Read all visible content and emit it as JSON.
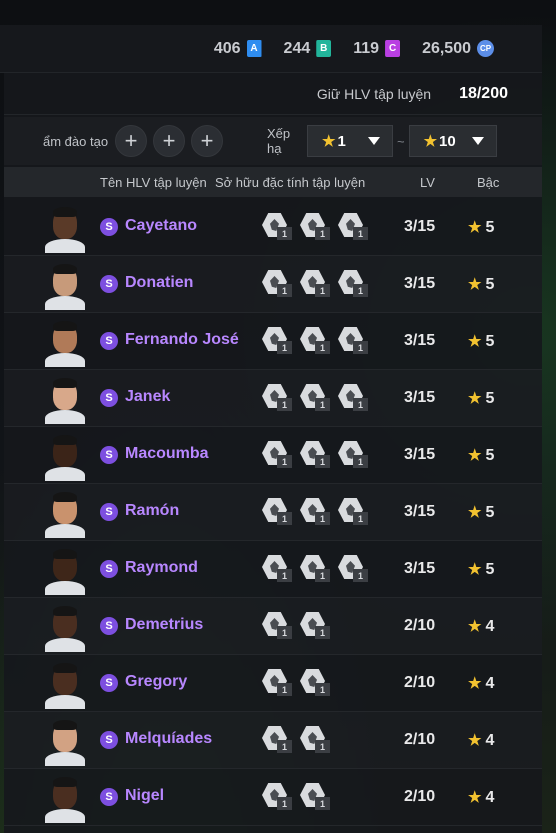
{
  "currencies": [
    {
      "value": "406",
      "badge": "A",
      "color": "#2f8df0"
    },
    {
      "value": "244",
      "badge": "B",
      "color": "#22b59b"
    },
    {
      "value": "119",
      "badge": "C",
      "color": "#b93fe2"
    },
    {
      "value": "26,500",
      "badge": "CP",
      "color": "#5c8ee8"
    }
  ],
  "coach_count": {
    "label": "Giữ HLV tập luyện",
    "value": "18/200"
  },
  "filter": {
    "training_label": "ẩm đào tạo",
    "plus": "+",
    "rank_label": "Xếp hạ",
    "rank_from": "1",
    "rank_to": "10",
    "tilde": "~",
    "star": "★"
  },
  "columns": {
    "name": "Tên HLV tập luyện",
    "traits": "Sở hữu đặc tính tập luyện",
    "lv": "LV",
    "grade": "Bậc"
  },
  "coaches": [
    {
      "name": "Cayetano",
      "lv": "3/15",
      "grade": "5",
      "traits": 3,
      "skin": "#5a3a28"
    },
    {
      "name": "Donatien",
      "lv": "3/15",
      "grade": "5",
      "traits": 3,
      "skin": "#c79a7a"
    },
    {
      "name": "Fernando José",
      "lv": "3/15",
      "grade": "5",
      "traits": 3,
      "skin": "#b07a58"
    },
    {
      "name": "Janek",
      "lv": "3/15",
      "grade": "5",
      "traits": 3,
      "skin": "#d8a88a"
    },
    {
      "name": "Macoumba",
      "lv": "3/15",
      "grade": "5",
      "traits": 3,
      "skin": "#3b2418"
    },
    {
      "name": "Ramón",
      "lv": "3/15",
      "grade": "5",
      "traits": 3,
      "skin": "#c9926d"
    },
    {
      "name": "Raymond",
      "lv": "3/15",
      "grade": "5",
      "traits": 3,
      "skin": "#3e2619"
    },
    {
      "name": "Demetrius",
      "lv": "2/10",
      "grade": "4",
      "traits": 2,
      "skin": "#4a2e20"
    },
    {
      "name": "Gregory",
      "lv": "2/10",
      "grade": "4",
      "traits": 2,
      "skin": "#4a2e20"
    },
    {
      "name": "Melquíades",
      "lv": "2/10",
      "grade": "4",
      "traits": 2,
      "skin": "#d2a283"
    },
    {
      "name": "Nigel",
      "lv": "2/10",
      "grade": "4",
      "traits": 2,
      "skin": "#4a2e20"
    }
  ],
  "trait_level": "1",
  "s_badge": "S"
}
